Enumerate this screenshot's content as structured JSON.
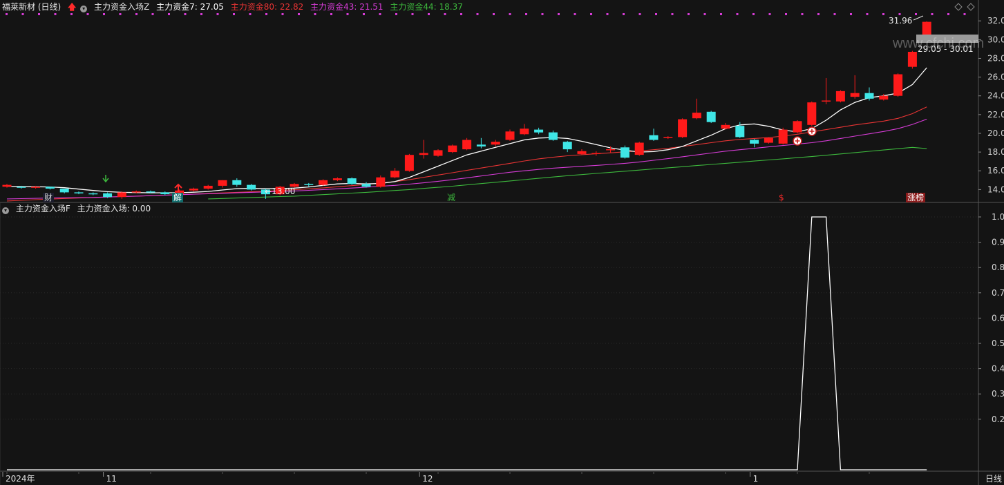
{
  "header": {
    "stock": "福莱新材 (日线)",
    "indicator": "主力资金入场Z",
    "items": [
      {
        "label": "主力资金7: 27.05",
        "color": "#ffffff"
      },
      {
        "label": "主力资金80: 22.82",
        "color": "#e83434"
      },
      {
        "label": "主力资金43: 21.51",
        "color": "#d63cd6"
      },
      {
        "label": "主力资金44: 18.37",
        "color": "#3db83d"
      }
    ]
  },
  "sub_header": {
    "indicator": "主力资金入场F",
    "value_label": "主力资金入场: 0.00"
  },
  "watermark": "www.cfchi.com",
  "annotations": {
    "high_label": "31.96",
    "range_label": "29.05 - 30.01",
    "low_label": "←13.00",
    "marks": [
      "财",
      "解",
      "减",
      "$",
      "涨榜"
    ]
  },
  "colors": {
    "up": "#ff1a1a",
    "down": "#3fe6e6",
    "ma7": "#ffffff",
    "ma80": "#e83434",
    "ma43": "#d63cd6",
    "ma44": "#3db83d",
    "dot": "#d63cd6",
    "axis": "#8a8a8a"
  },
  "footer": {
    "period_button": "日线"
  },
  "chart_data": [
    {
      "type": "candlestick",
      "yticks": [
        "14.00",
        "16.00",
        "18.00",
        "20.00",
        "22.00",
        "24.00",
        "26.00",
        "28.00",
        "30.00",
        "32.00"
      ],
      "ylim": [
        12.7,
        32.9
      ],
      "xticks": [
        {
          "label": "2024年",
          "i": 0
        },
        {
          "label": "11",
          "i": 7
        },
        {
          "label": "12",
          "i": 29
        },
        {
          "label": "1",
          "i": 52
        }
      ],
      "ohlc": [
        [
          14.3,
          14.5,
          14.6,
          14.2
        ],
        [
          14.3,
          14.2,
          14.4,
          14.1
        ],
        [
          14.2,
          14.3,
          14.4,
          14.1
        ],
        [
          14.3,
          14.1,
          14.3,
          14.0
        ],
        [
          14.1,
          13.7,
          14.1,
          13.6
        ],
        [
          13.7,
          13.6,
          13.8,
          13.5
        ],
        [
          13.6,
          13.5,
          13.7,
          13.4
        ],
        [
          13.6,
          13.2,
          13.7,
          13.1
        ],
        [
          13.2,
          13.7,
          13.8,
          13.0
        ],
        [
          13.7,
          13.8,
          13.9,
          13.6
        ],
        [
          13.8,
          13.7,
          13.9,
          13.6
        ],
        [
          13.7,
          13.5,
          13.8,
          13.4
        ],
        [
          13.5,
          13.9,
          14.0,
          13.4
        ],
        [
          13.9,
          14.1,
          14.2,
          13.8
        ],
        [
          14.1,
          14.4,
          14.5,
          14.0
        ],
        [
          14.4,
          15.0,
          15.0,
          14.2
        ],
        [
          15.0,
          14.5,
          15.2,
          14.3
        ],
        [
          14.5,
          14.0,
          14.6,
          13.9
        ],
        [
          14.0,
          13.5,
          14.1,
          13.0
        ],
        [
          13.5,
          14.3,
          14.4,
          13.4
        ],
        [
          14.3,
          14.6,
          14.7,
          14.2
        ],
        [
          14.6,
          14.5,
          14.7,
          14.3
        ],
        [
          14.5,
          15.0,
          15.1,
          14.4
        ],
        [
          15.0,
          15.2,
          15.3,
          14.9
        ],
        [
          15.2,
          14.6,
          15.3,
          14.5
        ],
        [
          14.6,
          14.3,
          14.8,
          14.2
        ],
        [
          14.3,
          15.3,
          15.5,
          14.2
        ],
        [
          15.3,
          16.0,
          16.3,
          15.2
        ],
        [
          16.0,
          17.7,
          17.8,
          15.9
        ],
        [
          17.7,
          17.9,
          19.3,
          17.3
        ],
        [
          17.6,
          18.2,
          18.3,
          17.5
        ],
        [
          18.0,
          18.7,
          18.8,
          17.9
        ],
        [
          18.3,
          19.3,
          19.5,
          18.2
        ],
        [
          18.8,
          18.6,
          19.5,
          18.4
        ],
        [
          18.8,
          19.1,
          19.3,
          18.6
        ],
        [
          19.3,
          20.2,
          20.4,
          19.2
        ],
        [
          19.9,
          20.5,
          21.0,
          19.8
        ],
        [
          20.4,
          20.1,
          20.6,
          19.9
        ],
        [
          20.1,
          19.3,
          20.3,
          19.2
        ],
        [
          19.1,
          18.3,
          19.2,
          18.0
        ],
        [
          17.8,
          18.1,
          18.3,
          17.7
        ],
        [
          17.8,
          17.9,
          18.1,
          17.6
        ],
        [
          18.2,
          18.3,
          18.6,
          17.9
        ],
        [
          18.5,
          17.4,
          18.7,
          17.3
        ],
        [
          17.7,
          19.0,
          19.1,
          17.6
        ],
        [
          19.8,
          19.3,
          20.5,
          19.2
        ],
        [
          19.5,
          19.6,
          19.7,
          19.4
        ],
        [
          19.6,
          21.5,
          21.6,
          19.5
        ],
        [
          21.6,
          22.2,
          23.7,
          21.5
        ],
        [
          22.3,
          21.2,
          22.4,
          21.1
        ],
        [
          20.5,
          20.9,
          21.1,
          20.4
        ],
        [
          20.8,
          19.6,
          21.2,
          19.5
        ],
        [
          19.3,
          18.9,
          19.4,
          18.5
        ],
        [
          19.0,
          19.5,
          19.6,
          18.9
        ],
        [
          18.9,
          20.4,
          20.6,
          18.8
        ],
        [
          20.1,
          21.3,
          21.4,
          20.0
        ],
        [
          20.9,
          23.3,
          23.4,
          20.8
        ],
        [
          23.4,
          23.5,
          25.9,
          23.1
        ],
        [
          23.4,
          24.5,
          24.6,
          23.3
        ],
        [
          23.9,
          24.3,
          26.2,
          23.7
        ],
        [
          24.3,
          23.7,
          24.9,
          23.5
        ],
        [
          23.6,
          24.0,
          24.2,
          23.5
        ],
        [
          24.0,
          26.3,
          26.4,
          23.9
        ],
        [
          27.1,
          28.7,
          28.8,
          26.9
        ],
        [
          30.4,
          31.9,
          31.96,
          30.3
        ]
      ],
      "ma7": [
        14.35,
        14.32,
        14.3,
        14.28,
        14.2,
        14.05,
        13.9,
        13.78,
        13.7,
        13.68,
        13.65,
        13.66,
        13.66,
        13.72,
        13.8,
        13.95,
        14.1,
        14.12,
        14.1,
        14.1,
        14.15,
        14.28,
        14.45,
        14.6,
        14.65,
        14.6,
        14.65,
        14.85,
        15.3,
        15.9,
        16.5,
        17.1,
        17.7,
        18.1,
        18.5,
        18.9,
        19.3,
        19.5,
        19.55,
        19.45,
        19.15,
        18.8,
        18.45,
        18.2,
        18.0,
        18.05,
        18.25,
        18.6,
        19.2,
        19.8,
        20.5,
        20.9,
        21.0,
        20.75,
        20.35,
        20.15,
        20.5,
        21.4,
        22.5,
        23.3,
        23.8,
        24.0,
        24.3,
        25.2,
        27.0
      ],
      "ma80": [
        12.78,
        12.85,
        12.92,
        12.98,
        13.05,
        13.1,
        13.15,
        13.2,
        13.25,
        13.3,
        13.35,
        13.4,
        13.46,
        13.52,
        13.58,
        13.64,
        13.7,
        13.76,
        13.82,
        13.9,
        13.98,
        14.08,
        14.18,
        14.3,
        14.42,
        14.55,
        14.7,
        14.85,
        15.05,
        15.3,
        15.55,
        15.8,
        16.05,
        16.3,
        16.55,
        16.8,
        17.05,
        17.28,
        17.45,
        17.6,
        17.72,
        17.82,
        17.92,
        18.02,
        18.12,
        18.25,
        18.4,
        18.6,
        18.8,
        19.0,
        19.2,
        19.35,
        19.45,
        19.55,
        19.7,
        19.9,
        20.15,
        20.4,
        20.65,
        20.9,
        21.1,
        21.3,
        21.6,
        22.1,
        22.82
      ],
      "ma43": [
        13.0,
        13.03,
        13.06,
        13.1,
        13.12,
        13.14,
        13.16,
        13.2,
        13.25,
        13.3,
        13.35,
        13.4,
        13.45,
        13.5,
        13.55,
        13.6,
        13.65,
        13.7,
        13.75,
        13.8,
        13.85,
        13.92,
        14.0,
        14.08,
        14.16,
        14.25,
        14.35,
        14.45,
        14.58,
        14.72,
        14.88,
        15.05,
        15.25,
        15.45,
        15.65,
        15.85,
        16.0,
        16.15,
        16.28,
        16.38,
        16.48,
        16.58,
        16.68,
        16.8,
        16.95,
        17.12,
        17.3,
        17.5,
        17.7,
        17.9,
        18.1,
        18.25,
        18.4,
        18.55,
        18.7,
        18.85,
        19.0,
        19.2,
        19.45,
        19.7,
        19.95,
        20.2,
        20.5,
        20.95,
        21.51
      ],
      "ma44": [
        null,
        null,
        null,
        null,
        null,
        null,
        null,
        null,
        null,
        null,
        null,
        null,
        null,
        null,
        13.0,
        13.05,
        13.1,
        13.15,
        13.2,
        13.25,
        13.3,
        13.38,
        13.46,
        13.54,
        13.62,
        13.7,
        13.8,
        13.9,
        14.0,
        14.12,
        14.24,
        14.36,
        14.5,
        14.64,
        14.78,
        14.92,
        15.06,
        15.2,
        15.34,
        15.48,
        15.6,
        15.72,
        15.84,
        15.96,
        16.08,
        16.2,
        16.32,
        16.44,
        16.56,
        16.68,
        16.8,
        16.92,
        17.04,
        17.16,
        17.28,
        17.4,
        17.52,
        17.66,
        17.8,
        17.94,
        18.08,
        18.22,
        18.36,
        18.5,
        18.37
      ]
    },
    {
      "type": "line",
      "name": "主力资金入场",
      "yticks": [
        "0.2",
        "0.3",
        "0.4",
        "0.5",
        "0.6",
        "0.7",
        "0.8",
        "0.9",
        "1.0"
      ],
      "ylim": [
        0,
        1.0
      ],
      "values": [
        0,
        0,
        0,
        0,
        0,
        0,
        0,
        0,
        0,
        0,
        0,
        0,
        0,
        0,
        0,
        0,
        0,
        0,
        0,
        0,
        0,
        0,
        0,
        0,
        0,
        0,
        0,
        0,
        0,
        0,
        0,
        0,
        0,
        0,
        0,
        0,
        0,
        0,
        0,
        0,
        0,
        0,
        0,
        0,
        0,
        0,
        0,
        0,
        0,
        0,
        0,
        0,
        0,
        0,
        0,
        0,
        1,
        1,
        0,
        0,
        0,
        0,
        0,
        0,
        0
      ]
    }
  ]
}
